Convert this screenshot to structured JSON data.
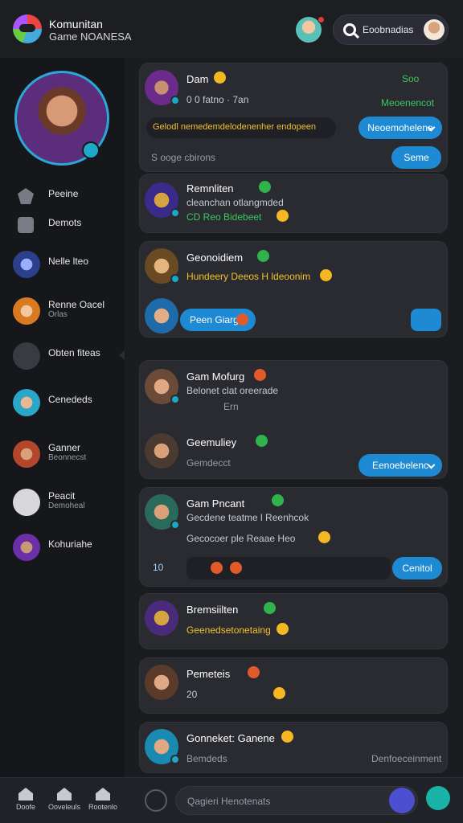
{
  "header": {
    "app_title": "Komunitan",
    "app_subtitle": "Game NOANESA",
    "search_label": "Eoobnadias"
  },
  "sidebar": {
    "items": [
      {
        "l1": "Peeine",
        "l2": ""
      },
      {
        "l1": "Demots",
        "l2": ""
      },
      {
        "l1": "Nelle lteo",
        "l2": ""
      },
      {
        "l1": "Renne Oacel",
        "l2": "Orlas"
      },
      {
        "l1": "Obten fiteas",
        "l2": ""
      },
      {
        "l1": "Cenededs",
        "l2": ""
      },
      {
        "l1": "Ganner",
        "l2": "Beonnecst"
      },
      {
        "l1": "Peacit",
        "l2": "Demoheal"
      },
      {
        "l1": "Kohuriahe",
        "l2": ""
      }
    ]
  },
  "feed": {
    "card1": {
      "name": "Dam",
      "top_right": "Soo",
      "meta": "0 0 fatno · 7an",
      "tag": "Meoenencot",
      "highlight": "Gelodl nemedemdelodenenher endopeen",
      "dropdown": "Neoemohelene",
      "footer": "S ooge cbirons",
      "button": "Seme"
    },
    "card2": {
      "name": "Remnliten",
      "line1": "cleanchan otlangmded",
      "line2": "CD Reo Bidebeet"
    },
    "card3": {
      "name": "Geonoidiem",
      "line1": "Hundeery Deeos H ldeoonim",
      "chip": "Peen Giarg"
    },
    "card4": {
      "name": "Gam Mofurg",
      "line1": "Belonet clat oreerade",
      "line2": "Ern"
    },
    "card5": {
      "name": "Geemuliey",
      "line1": "Gemdecct",
      "dropdown": "Eenoebelenc"
    },
    "card6": {
      "name": "Gam Pncant",
      "line1": "Gecdene teatme l Reenhcok",
      "line2": "Gecocoer ple Reaae Heo",
      "count": "10",
      "button": "Cenitol"
    },
    "card7": {
      "name": "Bremsiilten",
      "line1": "Geenedsetonetaing"
    },
    "card8": {
      "name": "Pemeteis",
      "line1": "20"
    },
    "card9": {
      "name": "Gonneket: Ganene",
      "line1": "Bemdeds",
      "right": "Denfoeceinment"
    }
  },
  "bottom": {
    "nav": [
      "Doofe",
      "Ooveleuls",
      "Rootenlo"
    ],
    "input_placeholder": "Qagieri Henotenats"
  }
}
